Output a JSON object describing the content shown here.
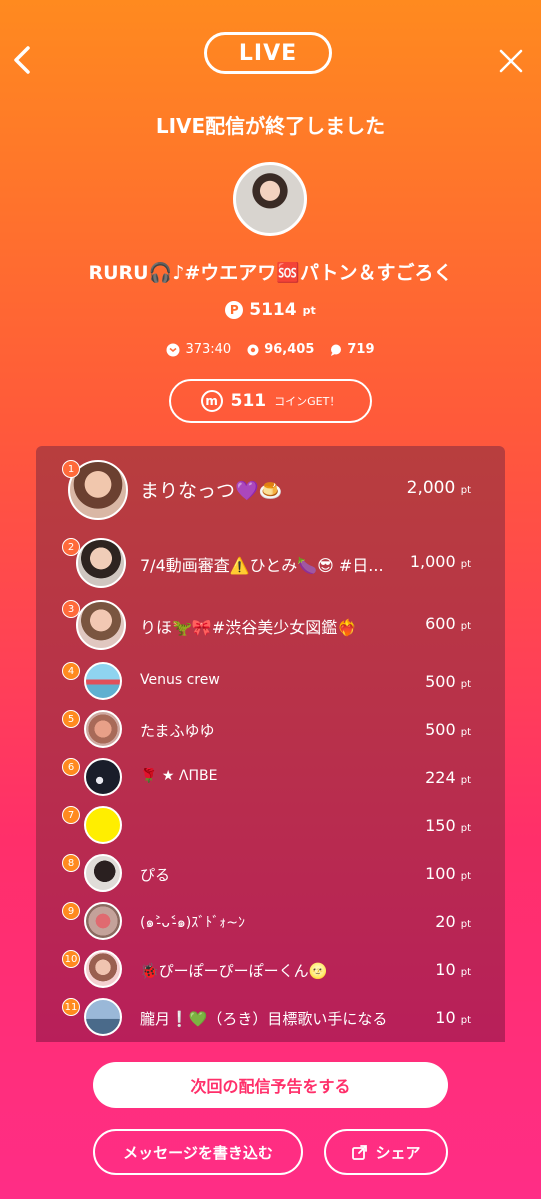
{
  "header": {
    "live_label": "LIVE"
  },
  "ended_text": "LIVE配信が終了しました",
  "stream_title": "RURU🎧♪#ウエアワ🆘パトン＆すごろく",
  "points": {
    "value": "5114",
    "unit": "pt",
    "icon": "P"
  },
  "stats": {
    "duration": "373:40",
    "views": "96,405",
    "comments": "719"
  },
  "coins": {
    "value": "511",
    "label": "コインGET！",
    "icon": "m"
  },
  "ranking": [
    {
      "rank": "1",
      "name": "まりなっつ💜🍮",
      "points": "2,000",
      "unit": "pt"
    },
    {
      "rank": "2",
      "name": "7/4動画審査⚠️ひとみ🍆😎 #日...",
      "points": "1,000",
      "unit": "pt"
    },
    {
      "rank": "3",
      "name": "りほ🦖🎀#渋谷美少女図鑑❤️‍🔥",
      "points": "600",
      "unit": "pt"
    },
    {
      "rank": "4",
      "name": "Venus crew",
      "points": "500",
      "unit": "pt"
    },
    {
      "rank": "5",
      "name": "たまふゆゆ",
      "points": "500",
      "unit": "pt"
    },
    {
      "rank": "6",
      "name": "🌹 ★ ΛΠΒΕ",
      "points": "224",
      "unit": "pt"
    },
    {
      "rank": "7",
      "name": "",
      "points": "150",
      "unit": "pt"
    },
    {
      "rank": "8",
      "name": "ぴる",
      "points": "100",
      "unit": "pt"
    },
    {
      "rank": "9",
      "name": "(๑˃̵ᴗ˂̵๑)ｽﾞﾄﾞｫ~ﾝ",
      "points": "20",
      "unit": "pt"
    },
    {
      "rank": "10",
      "name": "🐞ぴーぽーぴーぽーくん🌝",
      "points": "10",
      "unit": "pt"
    },
    {
      "rank": "11",
      "name": "朧月❕💚（ろき）目標歌い手になる",
      "points": "10",
      "unit": "pt"
    }
  ],
  "buttons": {
    "schedule": "次回の配信予告をする",
    "message": "メッセージを書き込む",
    "share": "シェア"
  }
}
